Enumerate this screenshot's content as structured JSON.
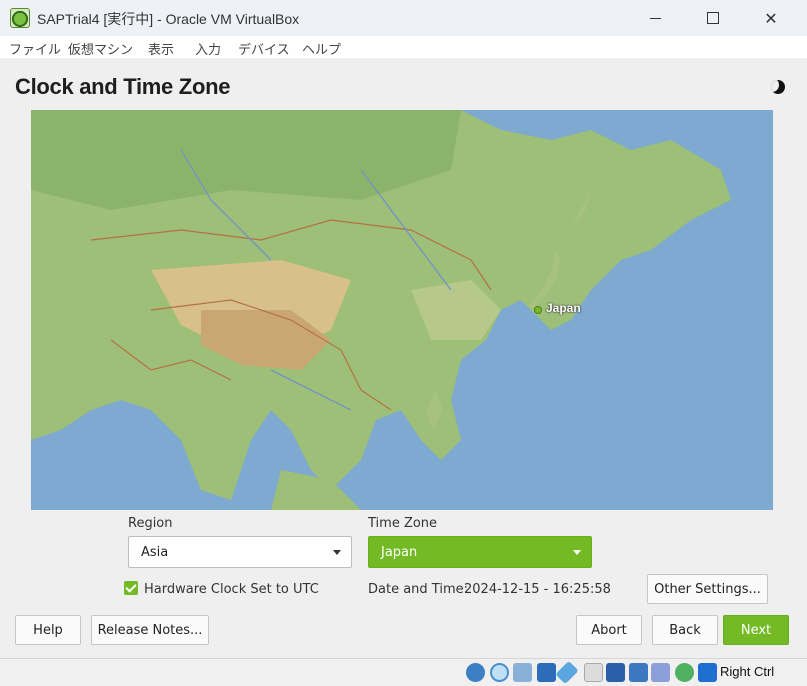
{
  "window": {
    "title": "SAPTrial4 [実行中] - Oracle VM VirtualBox",
    "min_icon": "minimize-icon",
    "max_icon": "maximize-icon",
    "close_icon": "close-icon",
    "close_glyph": "✕"
  },
  "menu": [
    "ファイル",
    "仮想マシン",
    "表示",
    "入力",
    "デバイス",
    "ヘルプ"
  ],
  "installer": {
    "title": "Clock and Time Zone",
    "map_label": "Japan",
    "region_label": "Region",
    "region_value": "Asia",
    "timezone_label": "Time Zone",
    "timezone_value": "Japan",
    "hw_clock_label": "Hardware Clock Set to UTC",
    "hw_clock_checked": true,
    "datetime_label": "Date and Time:",
    "datetime_value": "2024-12-15 - 16:25:58",
    "other_settings": "Other Settings...",
    "accent_color": "#73ba25"
  },
  "buttons": {
    "help": "Help",
    "release_notes": "Release Notes...",
    "abort": "Abort",
    "back": "Back",
    "next": "Next"
  },
  "statusbar": {
    "icons": [
      "disk-icon",
      "optical-disk-icon",
      "audio-icon",
      "network-icon",
      "usb-icon",
      "shared-folder-icon",
      "display-icon",
      "recording-icon",
      "cpu-icon",
      "mouse-integration-icon",
      "keyboard-icon"
    ],
    "host_key": "Right Ctrl"
  }
}
